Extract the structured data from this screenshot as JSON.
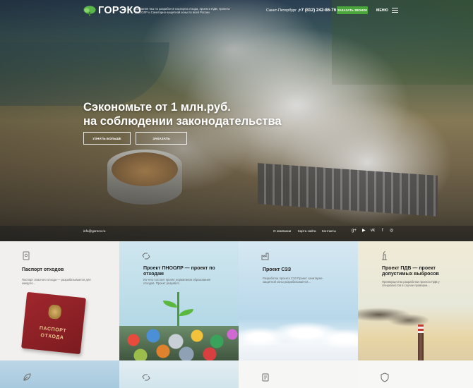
{
  "header": {
    "logo_text": "ГОРЭКО",
    "tagline": "Компания №1 по разработке паспорта отхода, проекта ПДВ, проекта ПНООЛР и Санитарно-защитной зоны по всей России",
    "city": "Санкт-Петербург",
    "phone": "+7 (812) 242-86-76",
    "order_label": "ЗАКАЗАТЬ ЗВОНОК",
    "menu_label": "МЕНЮ"
  },
  "hero": {
    "title_line1": "Сэкономьте от 1 млн.руб.",
    "title_line2": "на соблюдении законодательства",
    "more_label": "УЗНАТЬ БОЛЬШЕ",
    "order_label": "ЗАКАЗАТЬ"
  },
  "bar": {
    "email": "info@gorecо.ru",
    "links": [
      "О компании",
      "Карта сайта",
      "Контакты"
    ],
    "social": [
      "g+",
      "▶",
      "vk",
      "f",
      "◎"
    ]
  },
  "cards": [
    {
      "title": "Паспорт отходов",
      "desc": "Паспорт опасного отхода — разрабатывается для каждого..."
    },
    {
      "title": "Проект ПНООЛР — проект по отходам",
      "desc": "Из чего состоит проект нормативов образования отходов. Проект разработ..."
    },
    {
      "title": "Проект СЗЗ",
      "desc": "Разработка проекта СЗЗ Проект санитарно-защитной зоны разрабатывается..."
    },
    {
      "title": "Проект ПДВ — проект допустимых выбросов",
      "desc": "Преимущества разработки проекта ПДВ у специалистов в случае проверки..."
    }
  ],
  "passport": {
    "line1": "ПАСПОРТ",
    "line2": "ОТХОДА"
  },
  "colors": {
    "accent_green": "#4aa53a",
    "passport_red": "#8e2228"
  }
}
